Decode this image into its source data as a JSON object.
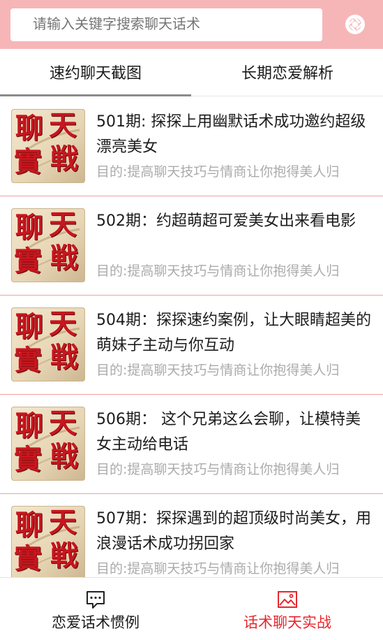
{
  "header": {
    "search_placeholder": "请输入关键字搜索聊天话术",
    "camera_icon": "camera-shutter-icon"
  },
  "tabs": [
    {
      "label": "速约聊天截图",
      "active": true
    },
    {
      "label": "长期恋爱解析",
      "active": false
    }
  ],
  "thumbnail_text": [
    "聊",
    "天",
    "實",
    "戦"
  ],
  "items": [
    {
      "title": "501期: 探探上用幽默话术成功邀约超级漂亮美女",
      "subtitle": "目的:提高聊天技巧与情商让你抱得美人归"
    },
    {
      "title": "502期：约超萌超可爱美女出来看电影",
      "subtitle": "目的:提高聊天技巧与情商让你抱得美人归"
    },
    {
      "title": "504期：探探速约案例，让大眼睛超美的萌妹子主动与你互动",
      "subtitle": "目的:提高聊天技巧与情商让你抱得美人归"
    },
    {
      "title": "506期： 这个兄弟这么会聊，让模特美女主动给电话",
      "subtitle": "目的:提高聊天技巧与情商让你抱得美人归"
    },
    {
      "title": "507期：探探遇到的超顶级时尚美女，用浪漫话术成功拐回家",
      "subtitle": "目的:提高聊天技巧与情商让你抱得美人归"
    }
  ],
  "bottom_nav": [
    {
      "label": "恋爱话术惯例",
      "icon": "chat-bubble-icon",
      "active": false
    },
    {
      "label": "话术聊天实战",
      "icon": "image-icon",
      "active": true
    }
  ],
  "colors": {
    "header_bg": "#f6b6b8",
    "active_nav": "#e8262d",
    "divider": "#f1a0a4",
    "tab_indicator": "#8b8b8b"
  }
}
